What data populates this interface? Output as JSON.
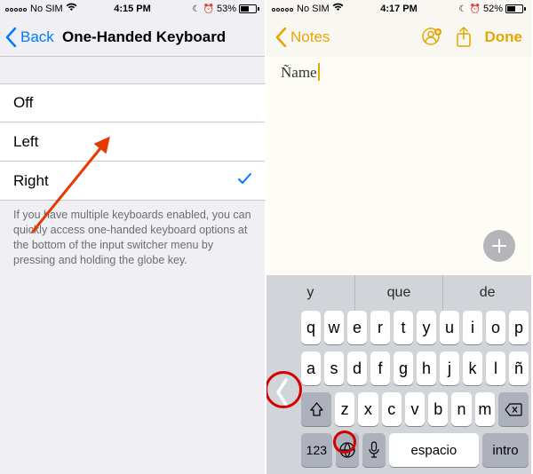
{
  "left": {
    "status": {
      "carrier": "No SIM",
      "time": "4:15 PM",
      "battery_pct": "53%"
    },
    "nav": {
      "back": "Back",
      "title": "One-Handed Keyboard"
    },
    "options": [
      {
        "label": "Off",
        "selected": false
      },
      {
        "label": "Left",
        "selected": false
      },
      {
        "label": "Right",
        "selected": true
      }
    ],
    "footer": "If you have multiple keyboards enabled, you can quickly access one-handed keyboard options at the bottom of the input switcher menu by pressing and holding the globe key."
  },
  "right": {
    "status": {
      "carrier": "No SIM",
      "time": "4:17 PM",
      "battery_pct": "52%"
    },
    "nav": {
      "back": "Notes",
      "done": "Done"
    },
    "note_text": "Ñame",
    "suggestions": [
      "y",
      "que",
      "de"
    ],
    "rows": {
      "r1": [
        "q",
        "w",
        "e",
        "r",
        "t",
        "y",
        "u",
        "i",
        "o",
        "p"
      ],
      "r2": [
        "a",
        "s",
        "d",
        "f",
        "g",
        "h",
        "j",
        "k",
        "l",
        "ñ"
      ],
      "r3": [
        "z",
        "x",
        "c",
        "v",
        "b",
        "n",
        "m"
      ]
    },
    "bottom": {
      "numbers": "123",
      "space": "espacio",
      "enter": "intro"
    }
  }
}
